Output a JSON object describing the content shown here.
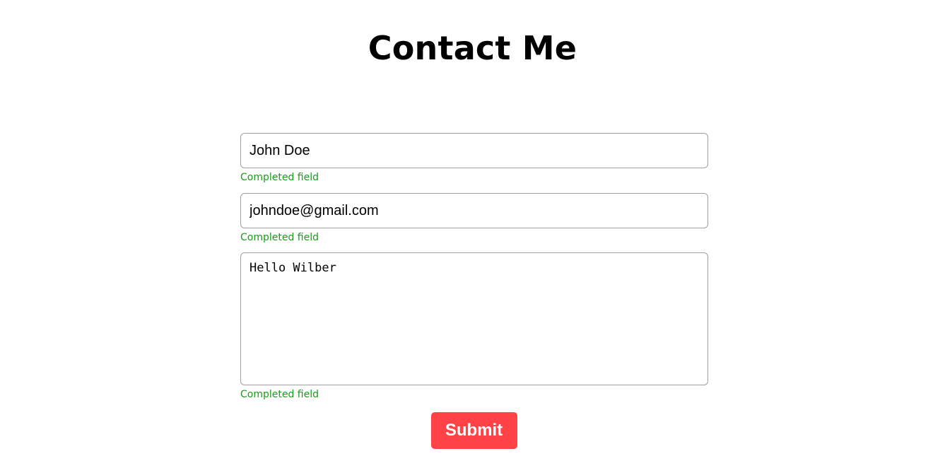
{
  "page": {
    "title": "Contact Me"
  },
  "form": {
    "name": {
      "value": "John Doe",
      "status": "Completed field"
    },
    "email": {
      "value": "johndoe@gmail.com",
      "status": "Completed field"
    },
    "message": {
      "value": "Hello Wilber",
      "status": "Completed field"
    },
    "submit_label": "Submit"
  },
  "colors": {
    "status_text": "#1a9a1a",
    "submit_background": "#ff4246",
    "field_border": "#9f9f9f"
  }
}
